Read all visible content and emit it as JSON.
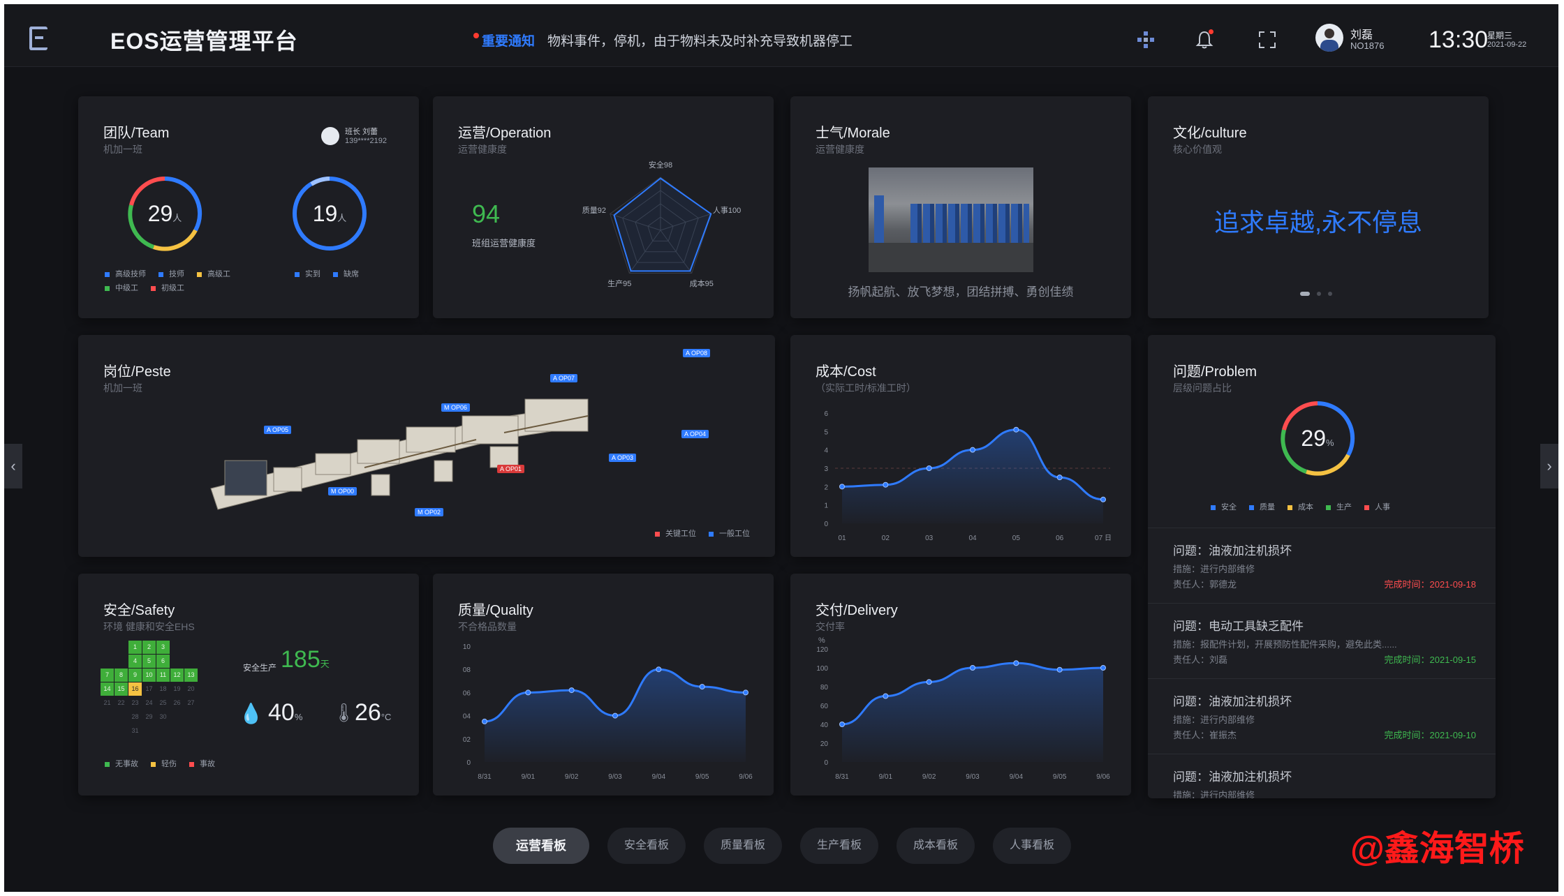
{
  "header": {
    "title": "EOS运营管理平台",
    "notice_label": "重要通知",
    "notice_text": "物料事件，停机，由于物料未及时补充导致机器停工",
    "user_name": "刘磊",
    "user_id": "NO1876",
    "time": "13:30",
    "weekday": "星期三",
    "date": "2021-09-22",
    "icons": [
      "app-grid-icon",
      "bell-icon",
      "fullscreen-icon"
    ]
  },
  "team": {
    "title": "团队/Team",
    "subtitle": "机加一班",
    "leader": "班长 刘蕾",
    "phone": "139****2192",
    "gauge1_value": "29",
    "gauge1_unit": "人",
    "gauge2_value": "19",
    "gauge2_unit": "人",
    "legend1": [
      {
        "label": "高级技师",
        "color": "#2f7bff"
      },
      {
        "label": "技师",
        "color": "#2f7bff"
      },
      {
        "label": "高级工",
        "color": "#f5c242"
      },
      {
        "label": "中级工",
        "color": "#3fb950"
      },
      {
        "label": "初级工",
        "color": "#ff4d4f"
      }
    ],
    "legend2": [
      {
        "label": "实到",
        "color": "#2f7bff"
      },
      {
        "label": "缺席",
        "color": "#2f7bff"
      }
    ]
  },
  "operation": {
    "title": "运营/Operation",
    "subtitle": "运营健康度",
    "score": "94",
    "score_label": "班组运营健康度",
    "radar_labels": [
      "安全98",
      "人事100",
      "成本95",
      "生产95",
      "质量92"
    ],
    "radar_values": [
      98,
      100,
      95,
      95,
      92
    ]
  },
  "morale": {
    "title": "士气/Morale",
    "subtitle": "运营健康度",
    "caption": "扬帆起航、放飞梦想，团结拼搏、勇创佳绩"
  },
  "culture": {
    "title": "文化/culture",
    "subtitle": "核心价值观",
    "slogan": "追求卓越,永不停息"
  },
  "post": {
    "title": "岗位/Peste",
    "subtitle": "机加一班",
    "tags": [
      "A OP08",
      "A OP07",
      "M OP06",
      "A OP05",
      "A OP04",
      "A OP03",
      "M OP02",
      "A OP01",
      "M OP00"
    ],
    "legend": [
      {
        "label": "关键工位",
        "color": "#ff4d4f"
      },
      {
        "label": "一般工位",
        "color": "#2f7bff"
      }
    ]
  },
  "cost": {
    "title": "成本/Cost",
    "subtitle": "（实际工时/标准工时）"
  },
  "problem": {
    "title": "问题/Problem",
    "subtitle": "层级问题占比",
    "gauge_value": "29",
    "gauge_unit": "%",
    "legend": [
      {
        "label": "安全",
        "color": "#2f7bff"
      },
      {
        "label": "质量",
        "color": "#2f7bff"
      },
      {
        "label": "成本",
        "color": "#f5c242"
      },
      {
        "label": "生产",
        "color": "#3fb950"
      },
      {
        "label": "人事",
        "color": "#ff4d4f"
      }
    ],
    "items": [
      {
        "title": "问题：油液加注机损坏",
        "measure": "措施：进行内部维修",
        "owner": "责任人：郭德龙",
        "done": "完成时间：2021-09-18",
        "done_color": "#ff4d4f"
      },
      {
        "title": "问题：电动工具缺乏配件",
        "measure": "措施：报配件计划，开展预防性配件采购，避免此类......",
        "owner": "责任人：刘磊",
        "done": "完成时间：2021-09-15",
        "done_color": "#3fb950"
      },
      {
        "title": "问题：油液加注机损坏",
        "measure": "措施：进行内部维修",
        "owner": "责任人：崔振杰",
        "done": "完成时间：2021-09-10",
        "done_color": "#3fb950"
      },
      {
        "title": "问题：油液加注机损坏",
        "measure": "措施：进行内部维修",
        "owner": "",
        "done": "",
        "done_color": "#3fb950"
      }
    ]
  },
  "safety": {
    "title": "安全/Safety",
    "subtitle": "环境 健康和安全EHS",
    "days_label": "安全生产",
    "days": "185",
    "days_unit": "天",
    "humidity": "40",
    "humidity_unit": "%",
    "temp": "26",
    "temp_unit": "°C",
    "calendar": [
      [
        "",
        "",
        "1",
        "2",
        "3",
        "",
        ""
      ],
      [
        "",
        "",
        "4",
        "5",
        "6",
        "",
        ""
      ],
      [
        "7",
        "8",
        "9",
        "10",
        "11",
        "12",
        "13"
      ],
      [
        "14",
        "15",
        "16",
        "17",
        "18",
        "19",
        "20"
      ],
      [
        "21",
        "22",
        "23",
        "24",
        "25",
        "26",
        "27"
      ],
      [
        "",
        "",
        "28",
        "29",
        "30",
        "",
        ""
      ],
      [
        "",
        "",
        "31",
        "",
        "",
        "",
        ""
      ]
    ],
    "legend": [
      {
        "label": "无事故",
        "color": "#3fb950"
      },
      {
        "label": "轻伤",
        "color": "#f5c242"
      },
      {
        "label": "事故",
        "color": "#ff4d4f"
      }
    ]
  },
  "quality": {
    "title": "质量/Quality",
    "subtitle": "不合格品数量"
  },
  "delivery": {
    "title": "交付/Delivery",
    "subtitle": "交付率",
    "unit": "%"
  },
  "tabs": [
    "运营看板",
    "安全看板",
    "质量看板",
    "生产看板",
    "成本看板",
    "人事看板"
  ],
  "watermark": "@鑫海智桥",
  "chart_data": [
    {
      "type": "area",
      "name": "cost",
      "x": [
        "01",
        "02",
        "03",
        "04",
        "05",
        "06",
        "07 日"
      ],
      "series": [
        {
          "values": [
            2.0,
            2.1,
            3.0,
            4.0,
            5.1,
            2.5,
            1.3
          ]
        }
      ],
      "yticks": [
        "0",
        "1",
        "2",
        "3",
        "4",
        "5",
        "6"
      ],
      "ylim": [
        0,
        6
      ],
      "refline": 3
    },
    {
      "type": "area",
      "name": "quality",
      "x": [
        "8/31",
        "9/01",
        "9/02",
        "9/03",
        "9/04",
        "9/05",
        "9/06"
      ],
      "series": [
        {
          "values": [
            3.5,
            6.0,
            6.2,
            4.0,
            8.0,
            6.5,
            6.0
          ]
        }
      ],
      "yticks": [
        "0",
        "02",
        "04",
        "06",
        "08",
        "10"
      ],
      "ylim": [
        0,
        10
      ]
    },
    {
      "type": "area",
      "name": "delivery",
      "x": [
        "8/31",
        "9/01",
        "9/02",
        "9/03",
        "9/04",
        "9/05",
        "9/06"
      ],
      "series": [
        {
          "values": [
            40,
            70,
            85,
            100,
            105,
            98,
            100
          ]
        }
      ],
      "yticks": [
        "0",
        "20",
        "40",
        "60",
        "80",
        "100",
        "120"
      ],
      "ylim": [
        0,
        120
      ]
    }
  ]
}
